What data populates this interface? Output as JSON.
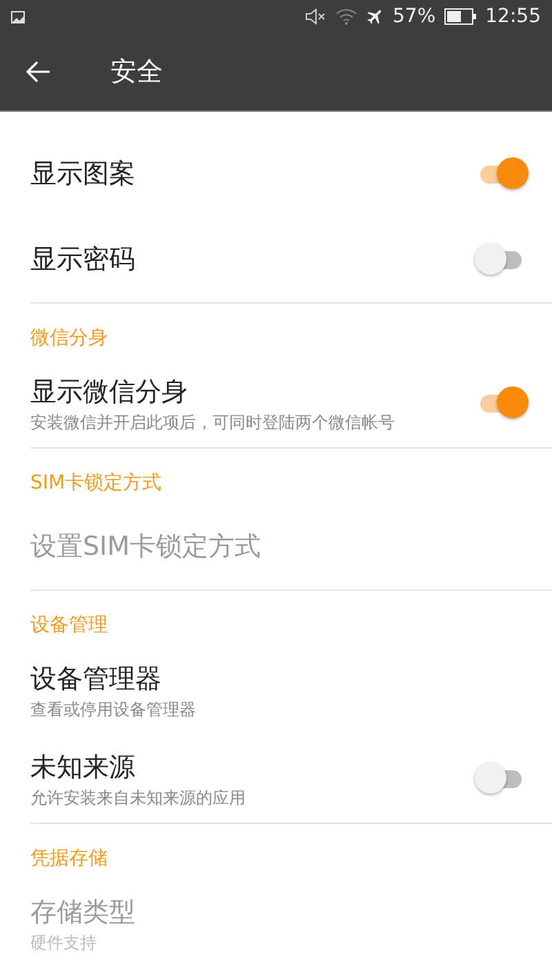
{
  "status_bar": {
    "battery": "57%",
    "time": "12:55"
  },
  "toolbar": {
    "title": "安全"
  },
  "groups": [
    {
      "items": [
        {
          "kind": "switch",
          "title": "显示图案",
          "on": true,
          "disabled": false
        },
        {
          "kind": "switch",
          "title": "显示密码",
          "on": false,
          "disabled": false
        }
      ]
    },
    {
      "header": "微信分身",
      "items": [
        {
          "kind": "switch",
          "title": "显示微信分身",
          "summary": "安装微信并开启此项后，可同时登陆两个微信帐号",
          "on": true,
          "disabled": false
        }
      ]
    },
    {
      "header": "SIM卡锁定方式",
      "items": [
        {
          "kind": "plain",
          "title": "设置SIM卡锁定方式",
          "disabled": true
        }
      ]
    },
    {
      "header": "设备管理",
      "items": [
        {
          "kind": "plain",
          "title": "设备管理器",
          "summary": "查看或停用设备管理器",
          "disabled": false
        },
        {
          "kind": "switch",
          "title": "未知来源",
          "summary": "允许安装来自未知来源的应用",
          "on": false,
          "disabled": false
        }
      ]
    },
    {
      "header": "凭据存储",
      "items": [
        {
          "kind": "plain",
          "title": "存储类型",
          "summary": "硬件支持",
          "disabled": true
        }
      ]
    }
  ]
}
